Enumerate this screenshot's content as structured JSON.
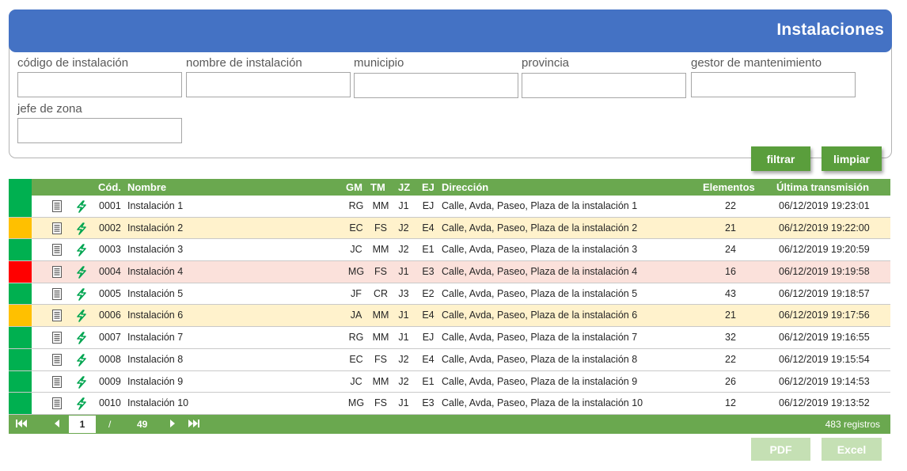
{
  "panel": {
    "title": "Instalaciones",
    "fields": {
      "code_label": "código de instalación",
      "name_label": "nombre de instalación",
      "municipality_label": "municipio",
      "province_label": "provincia",
      "manager_label": "gestor de mantenimiento",
      "zone_chief_label": "jefe de zona"
    },
    "filter_label": "filtrar",
    "clear_label": "limpiar"
  },
  "table": {
    "columns": {
      "code": "Cód.",
      "name": "Nombre",
      "gm": "GM",
      "tm": "TM",
      "jz": "JZ",
      "ej": "EJ",
      "address": "Dirección",
      "elements": "Elementos",
      "last_transmission": "Última transmisión"
    },
    "status_colors": {
      "ok": "#00b050",
      "warn": "#ffc000",
      "error": "#ff0000"
    },
    "rows": [
      {
        "status": "ok",
        "code": "0001",
        "name": "Instalación 1",
        "gm": "RG",
        "tm": "MM",
        "jz": "J1",
        "ej": "EJ",
        "address": "Calle, Avda, Paseo, Plaza de la instalación 1",
        "elements": "22",
        "last": "06/12/2019 19:23:01"
      },
      {
        "status": "warn",
        "code": "0002",
        "name": "Instalación 2",
        "gm": "EC",
        "tm": "FS",
        "jz": "J2",
        "ej": "E4",
        "address": "Calle, Avda, Paseo, Plaza de la instalación 2",
        "elements": "21",
        "last": "06/12/2019 19:22:00"
      },
      {
        "status": "ok",
        "code": "0003",
        "name": "Instalación 3",
        "gm": "JC",
        "tm": "MM",
        "jz": "J2",
        "ej": "E1",
        "address": "Calle, Avda, Paseo, Plaza de la instalación 3",
        "elements": "24",
        "last": "06/12/2019 19:20:59"
      },
      {
        "status": "error",
        "code": "0004",
        "name": "Instalación 4",
        "gm": "MG",
        "tm": "FS",
        "jz": "J1",
        "ej": "E3",
        "address": "Calle, Avda, Paseo, Plaza de la instalación 4",
        "elements": "16",
        "last": "06/12/2019 19:19:58"
      },
      {
        "status": "ok",
        "code": "0005",
        "name": "Instalación 5",
        "gm": "JF",
        "tm": "CR",
        "jz": "J3",
        "ej": "E2",
        "address": "Calle, Avda, Paseo, Plaza de la instalación 5",
        "elements": "43",
        "last": "06/12/2019 19:18:57"
      },
      {
        "status": "warn",
        "code": "0006",
        "name": "Instalación 6",
        "gm": "JA",
        "tm": "MM",
        "jz": "J1",
        "ej": "E4",
        "address": "Calle, Avda, Paseo, Plaza de la instalación 6",
        "elements": "21",
        "last": "06/12/2019 19:17:56"
      },
      {
        "status": "ok",
        "code": "0007",
        "name": "Instalación 7",
        "gm": "RG",
        "tm": "MM",
        "jz": "J1",
        "ej": "EJ",
        "address": "Calle, Avda, Paseo, Plaza de la instalación 7",
        "elements": "32",
        "last": "06/12/2019 19:16:55"
      },
      {
        "status": "ok",
        "code": "0008",
        "name": "Instalación 8",
        "gm": "EC",
        "tm": "FS",
        "jz": "J2",
        "ej": "E4",
        "address": "Calle, Avda, Paseo, Plaza de la instalación 8",
        "elements": "22",
        "last": "06/12/2019 19:15:54"
      },
      {
        "status": "ok",
        "code": "0009",
        "name": "Instalación 9",
        "gm": "JC",
        "tm": "MM",
        "jz": "J2",
        "ej": "E1",
        "address": "Calle, Avda, Paseo, Plaza de la instalación 9",
        "elements": "26",
        "last": "06/12/2019 19:14:53"
      },
      {
        "status": "ok",
        "code": "0010",
        "name": "Instalación 10",
        "gm": "MG",
        "tm": "FS",
        "jz": "J1",
        "ej": "E3",
        "address": "Calle, Avda, Paseo, Plaza de la instalación 10",
        "elements": "12",
        "last": "06/12/2019 19:13:52"
      }
    ],
    "row_icons": [
      "document-icon",
      "lightning-icon"
    ]
  },
  "pager": {
    "current_page": "1",
    "separator": "/",
    "total_pages": "49",
    "records": "483 registros"
  },
  "export": {
    "pdf_label": "PDF",
    "excel_label": "Excel"
  }
}
